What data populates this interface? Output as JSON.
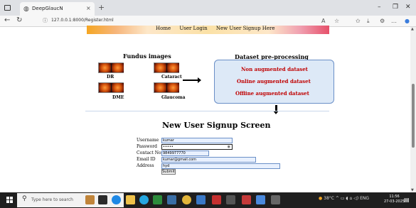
{
  "browser": {
    "tab_title": "DeepGlaucN",
    "url": "127.0.0.1:8000/Register.html",
    "new_tab": "+",
    "close": "×",
    "minimize": "–",
    "maximize": "❐",
    "window_close": "✕"
  },
  "nav": {
    "items": [
      "Home",
      "User Login",
      "New User Signup Here"
    ]
  },
  "diagram": {
    "left_title": "Fundus images",
    "labels": [
      "DR",
      "Cataract",
      "DME",
      "Glaucoma"
    ],
    "right_title": "Dataset pre-processing",
    "steps": [
      "Non augmented dataset",
      "Online augmented dataset",
      "Offline augmented dataset"
    ]
  },
  "form": {
    "title": "New User Signup Screen",
    "fields": [
      {
        "label": "Username",
        "value": "kumar"
      },
      {
        "label": "Password",
        "value": "•••••"
      },
      {
        "label": "Contact No",
        "value": "9849977770"
      },
      {
        "label": "Email ID",
        "value": "kumar@gmail.com"
      },
      {
        "label": "Address",
        "value": "hyd"
      }
    ],
    "submit": "Submit"
  },
  "taskbar": {
    "search_placeholder": "Type here to search",
    "weather": "38°C",
    "lang": "ENG",
    "time": "11:56",
    "date": "27-03-2025"
  },
  "colors": {
    "accent_red": "#c00000",
    "box_blue": "#dde9f7"
  }
}
